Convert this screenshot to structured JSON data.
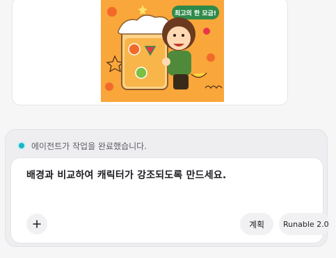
{
  "image": {
    "alt": "",
    "badge_text": "최고의 한 모금!"
  },
  "status": {
    "text": "에이전트가 작업을 완료했습니다."
  },
  "input": {
    "value": "배경과 비교하여 캐릭터가 강조되도록 만드세요."
  },
  "toolbar": {
    "plan_label": "계획",
    "model_label": "Runable 2.0"
  },
  "colors": {
    "accent": "#16b7c7",
    "illustration_bg": "#f9a63a"
  }
}
